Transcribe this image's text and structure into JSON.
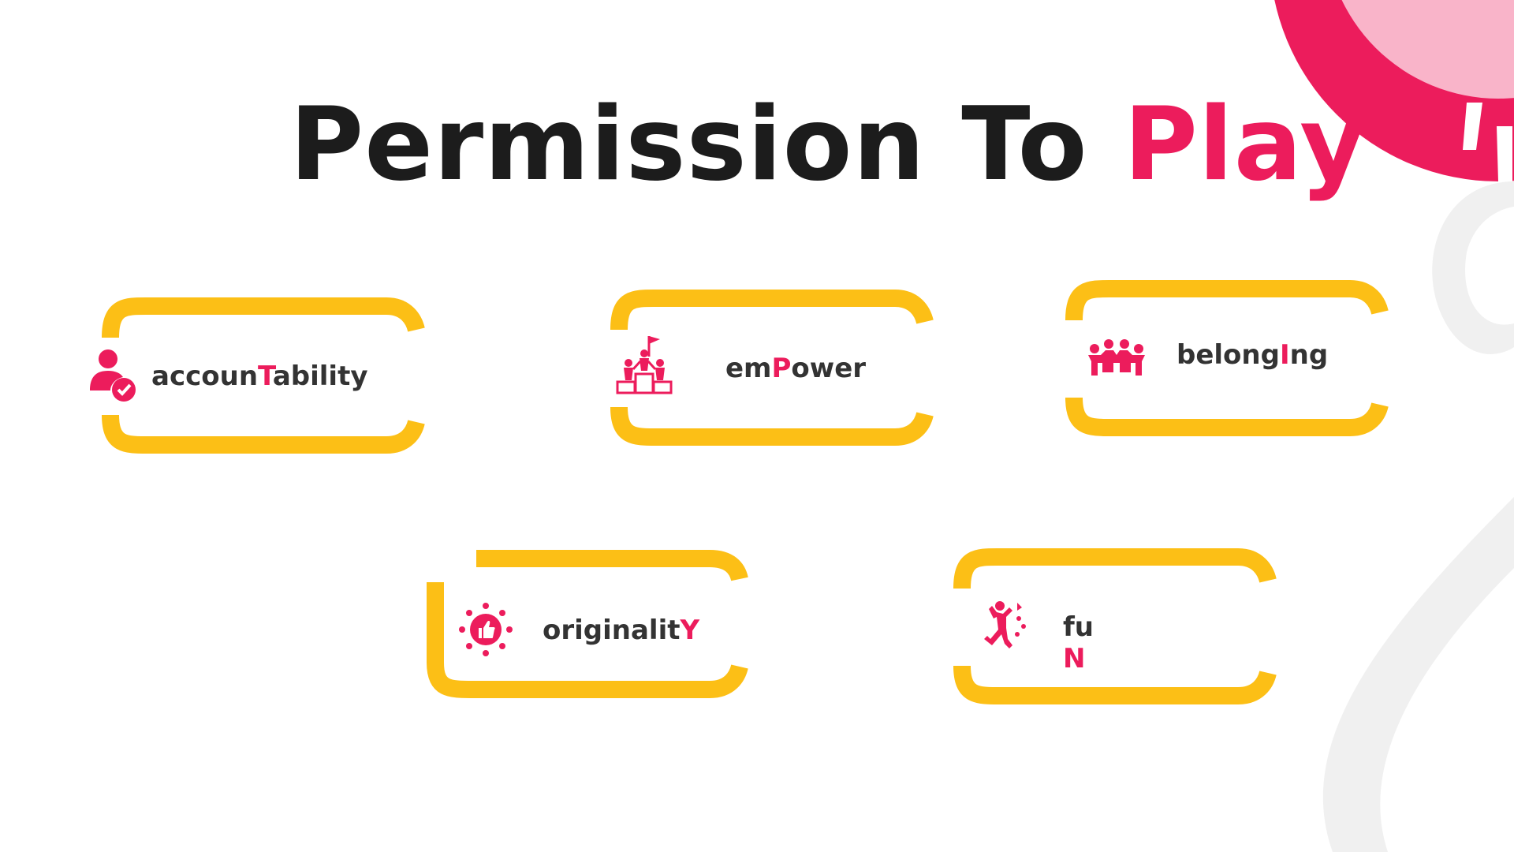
{
  "slide": {
    "title": {
      "main": "Permission To ",
      "accent": "Play"
    },
    "colors": {
      "accent": "#ec1c5c",
      "frame": "#fcbf16",
      "text": "#333333",
      "title": "#1c1c1c",
      "decor_light": "#f9b4c9",
      "decor_gray": "#f0f0f0"
    },
    "values": [
      {
        "icon": "user-check-icon",
        "before": "accoun",
        "highlight": "T",
        "after": "ability"
      },
      {
        "icon": "team-summit-flag-icon",
        "before": "em",
        "highlight": "P",
        "after": "ower"
      },
      {
        "icon": "people-group-icon",
        "before": "belong",
        "highlight": "I",
        "after": "ng"
      },
      {
        "icon": "thumbs-up-badge-icon",
        "before": "originalit",
        "highlight": "Y",
        "after": ""
      },
      {
        "icon": "jumping-person-icon",
        "before": "fu",
        "highlight": "N",
        "after": ""
      }
    ]
  }
}
